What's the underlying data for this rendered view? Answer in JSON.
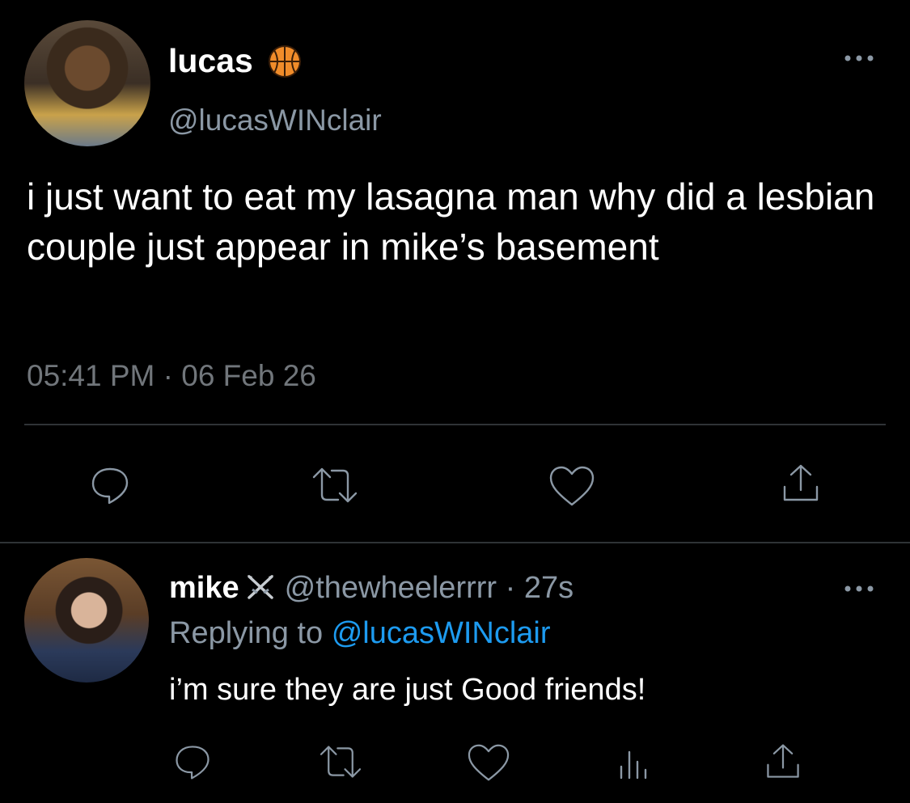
{
  "main_tweet": {
    "display_name": "lucas",
    "badge_icon": "basketball-icon",
    "handle": "@lucasWINclair",
    "text": "i just want to eat my lasagna man why did a lesbian couple just appear in mike’s basement",
    "timestamp": "05:41 PM · 06 Feb 26",
    "actions": [
      "reply-icon",
      "retweet-icon",
      "like-icon",
      "share-icon"
    ]
  },
  "reply_tweet": {
    "display_name": "mike",
    "badge_icon": "crossed-swords-icon",
    "handle": "@thewheelerrrr",
    "separator": "·",
    "time_ago": "27s",
    "replying_prefix": "Replying to",
    "replying_to": "@lucasWINclair",
    "text": "i’m sure they are just Good friends!",
    "actions": [
      "reply-icon",
      "retweet-icon",
      "like-icon",
      "analytics-icon",
      "share-icon"
    ]
  },
  "colors": {
    "background": "#000000",
    "primary_text": "#ffffff",
    "secondary_text": "#8b98a5",
    "link": "#1d9bf0",
    "divider": "#2f3336",
    "basketball": "#f08c2a"
  }
}
